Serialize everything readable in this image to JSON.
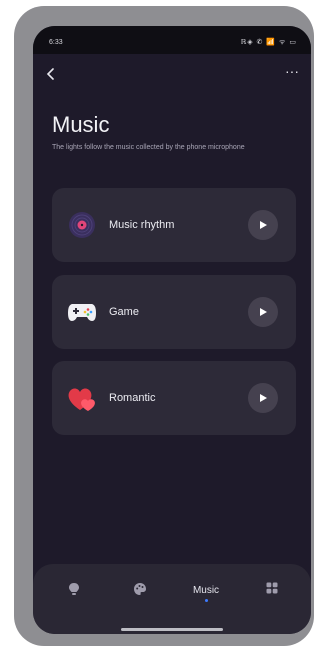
{
  "status_bar": {
    "time": "6:33",
    "icons_text": "ℝ◈ ✆ 📶 ᯤ ▭",
    "icon_names": [
      "nfc-icon",
      "bluetooth-icon",
      "signal-icon",
      "wifi-icon",
      "battery-icon"
    ]
  },
  "header": {
    "back_icon": "chevron-left-icon",
    "more_icon": "more-horizontal-icon",
    "more_glyph": "···"
  },
  "page": {
    "title": "Music",
    "subtitle": "The lights follow the music collected by the phone microphone"
  },
  "modes": [
    {
      "label": "Music rhythm",
      "icon": "vinyl-record-icon"
    },
    {
      "label": "Game",
      "icon": "gamepad-icon"
    },
    {
      "label": "Romantic",
      "icon": "hearts-icon"
    }
  ],
  "bottom_nav": {
    "items": [
      {
        "icon": "bulb-icon",
        "label": ""
      },
      {
        "icon": "palette-icon",
        "label": ""
      },
      {
        "icon": "",
        "label": "Music",
        "active": true
      },
      {
        "icon": "grid-icon",
        "label": ""
      }
    ]
  },
  "colors": {
    "background": "#1e1a2a",
    "card": "#2d2a38",
    "accent": "#3d7bff",
    "heart": "#e23a48"
  }
}
